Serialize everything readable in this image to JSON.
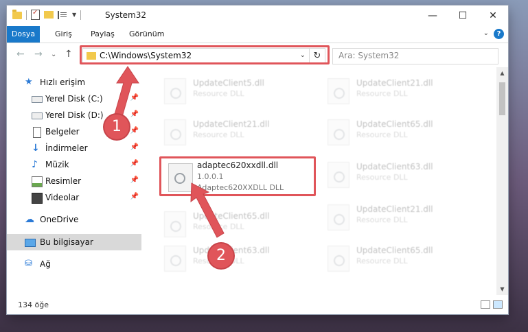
{
  "window": {
    "title": "System32",
    "controls": {
      "minimize": "—",
      "maximize": "☐",
      "close": "✕"
    }
  },
  "ribbon": {
    "tabs": [
      "Dosya",
      "Giriş",
      "Paylaş",
      "Görünüm"
    ],
    "expand": "⌄",
    "help": "?"
  },
  "nav": {
    "back": "←",
    "forward": "→",
    "recent": "⌄",
    "up": "↑",
    "address": "C:\\Windows\\System32",
    "address_dropdown": "⌄",
    "refresh": "↻",
    "search_placeholder": "Ara: System32"
  },
  "sidebar": {
    "items": [
      {
        "label": "Hızlı erişim",
        "icon": "quick-access-star-icon"
      },
      {
        "label": "Yerel Disk (C:)",
        "icon": "drive-icon",
        "pin": "📌"
      },
      {
        "label": "Yerel Disk (D:)",
        "icon": "drive-icon",
        "pin": "📌"
      },
      {
        "label": "Belgeler",
        "icon": "documents-icon",
        "pin": "📌"
      },
      {
        "label": "İndirmeler",
        "icon": "download-arrow-icon",
        "pin": "📌"
      },
      {
        "label": "Müzik",
        "icon": "music-note-icon",
        "pin": "📌"
      },
      {
        "label": "Resimler",
        "icon": "pictures-icon",
        "pin": "📌"
      },
      {
        "label": "Videolar",
        "icon": "video-film-icon",
        "pin": "📌"
      },
      {
        "label": "OneDrive",
        "icon": "cloud-icon"
      },
      {
        "label": "Bu bilgisayar",
        "icon": "computer-icon"
      },
      {
        "label": "Ağ",
        "icon": "network-icon"
      }
    ]
  },
  "files": {
    "left": [
      {
        "name": "UpdateClient5.dll",
        "type": "Resource DLL"
      },
      {
        "name": "UpdateClient21.dll",
        "type": "Resource DLL"
      },
      {
        "name": "adaptec620xxdll.dll",
        "version": "1.0.0.1",
        "type": "Adaptec620XXDLL DLL"
      },
      {
        "name": "UpdateClient65.dll",
        "type": "Resource DLL"
      },
      {
        "name": "UpdateClient63.dll",
        "type": "Resource DLL"
      }
    ],
    "right": [
      {
        "name": "UpdateClient21.dll",
        "type": "Resource DLL"
      },
      {
        "name": "UpdateClient65.dll",
        "type": "Resource DLL"
      },
      {
        "name": "UpdateClient63.dll",
        "type": "Resource DLL"
      },
      {
        "name": "UpdateClient21.dll",
        "type": "Resource DLL"
      },
      {
        "name": "UpdateClient65.dll",
        "type": "Resource DLL"
      }
    ]
  },
  "status": {
    "count": "134 öğe"
  },
  "annotations": {
    "marker1": "1",
    "marker2": "2",
    "color": "#e0555a"
  }
}
